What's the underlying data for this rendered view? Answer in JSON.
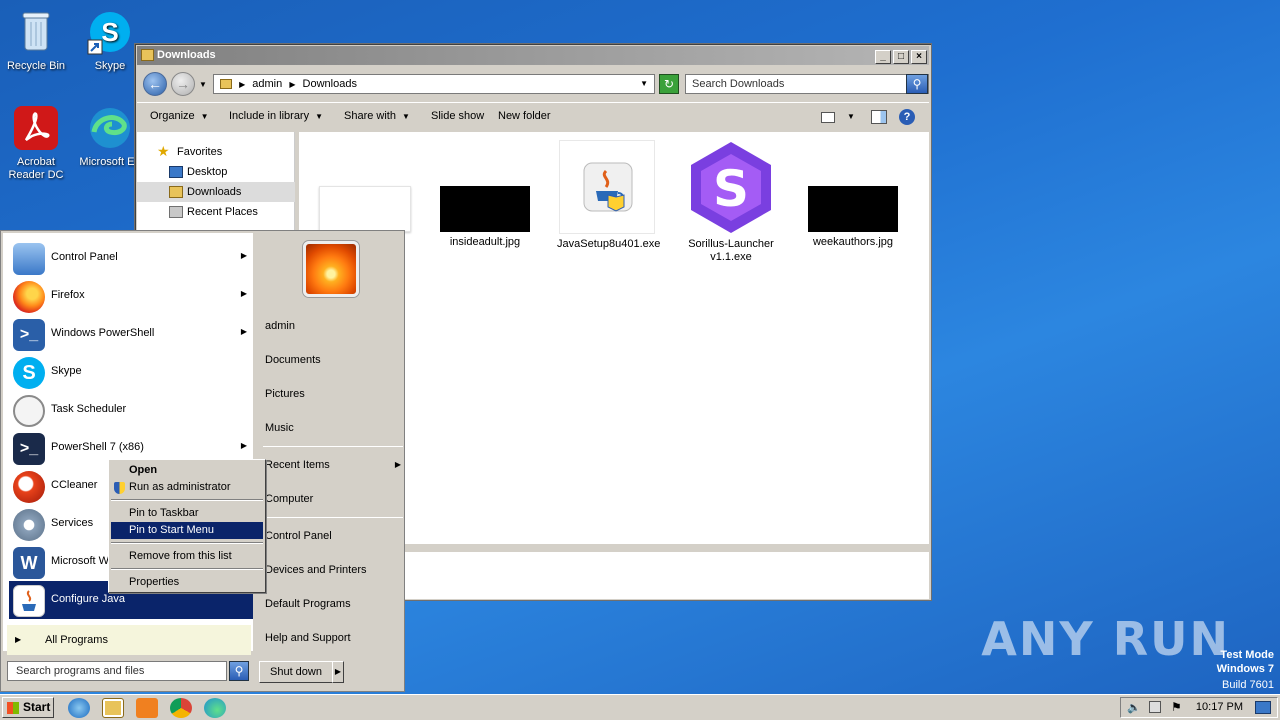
{
  "desktop": {
    "icons": [
      {
        "label": "Recycle Bin"
      },
      {
        "label": "Skype"
      },
      {
        "label": "Acrobat Reader DC"
      },
      {
        "label": "Microsoft Ed"
      }
    ]
  },
  "explorer": {
    "title": "Downloads",
    "address": [
      "admin",
      "Downloads"
    ],
    "search_placeholder": "Search Downloads",
    "commands": [
      "Organize",
      "Include in library",
      "Share with",
      "Slide show",
      "New folder"
    ],
    "nav": {
      "favorites": "Favorites",
      "items": [
        "Desktop",
        "Downloads",
        "Recent Places"
      ]
    },
    "files": [
      {
        "name": ""
      },
      {
        "name": "insideadult.jpg"
      },
      {
        "name": "JavaSetup8u401.exe"
      },
      {
        "name": "Sorillus-Launcher v1.1.exe"
      },
      {
        "name": "weekauthors.jpg"
      }
    ]
  },
  "start_menu": {
    "programs": [
      "Control Panel",
      "Firefox",
      "Windows PowerShell",
      "Skype",
      "Task Scheduler",
      "PowerShell 7 (x86)",
      "CCleaner",
      "Services",
      "Microsoft W",
      "Configure Java"
    ],
    "all_programs": "All Programs",
    "search_placeholder": "Search programs and files",
    "right": [
      "admin",
      "Documents",
      "Pictures",
      "Music",
      "Recent Items",
      "Computer",
      "Control Panel",
      "Devices and Printers",
      "Default Programs",
      "Help and Support"
    ],
    "shutdown": "Shut down"
  },
  "context_menu": {
    "items": [
      "Open",
      "Run as administrator",
      "Pin to Taskbar",
      "Pin to Start Menu",
      "Remove from this list",
      "Properties"
    ]
  },
  "taskbar": {
    "start": "Start",
    "clock": "10:17 PM"
  },
  "watermark": "ANY RUN",
  "test_mode": [
    "Test Mode",
    "Windows 7",
    "Build 7601"
  ]
}
